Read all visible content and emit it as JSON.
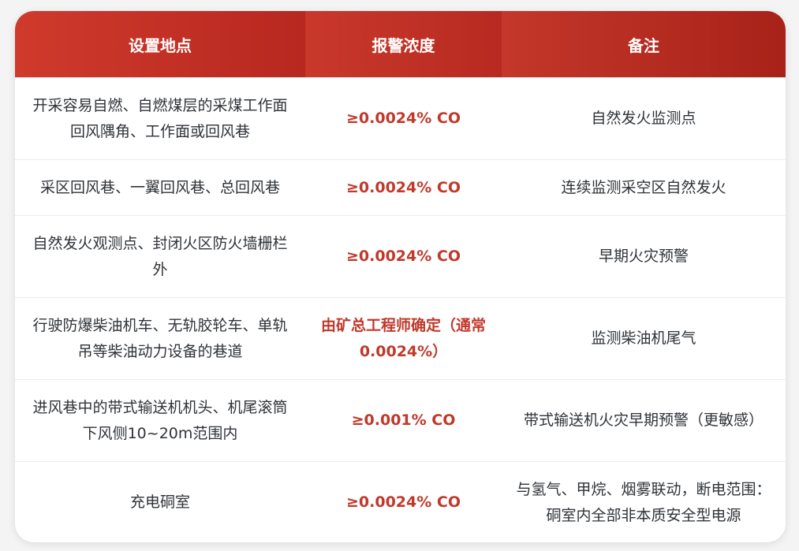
{
  "table": {
    "headers": [
      "设置地点",
      "报警浓度",
      "备注"
    ],
    "rows": [
      {
        "location": "开采容易自燃、自燃煤层的采煤工作面回风隅角、工作面或回风巷",
        "concentration": "≥0.0024% CO",
        "note": "自然发火监测点"
      },
      {
        "location": "采区回风巷、一翼回风巷、总回风巷",
        "concentration": "≥0.0024% CO",
        "note": "连续监测采空区自然发火"
      },
      {
        "location": "自然发火观测点、封闭火区防火墙栅栏外",
        "concentration": "≥0.0024% CO",
        "note": "早期火灾预警"
      },
      {
        "location": "行驶防爆柴油机车、无轨胶轮车、单轨吊等柴油动力设备的巷道",
        "concentration": "由矿总工程师确定（通常0.0024%）",
        "note": "监测柴油机尾气"
      },
      {
        "location": "进风巷中的带式输送机机头、机尾滚筒下风侧10~20m范围内",
        "concentration": "≥0.001% CO",
        "note": "带式输送机火灾早期预警（更敏感）"
      },
      {
        "location": "充电硐室",
        "concentration": "≥0.0024% CO",
        "note": "与氢气、甲烷、烟雾联动，断电范围：硐室内全部非本质安全型电源"
      }
    ]
  },
  "colors": {
    "header_bg": "#c0392b",
    "header_text": "#ffffff",
    "concentration_text": "#c0392b",
    "body_text": "#2f3338"
  }
}
